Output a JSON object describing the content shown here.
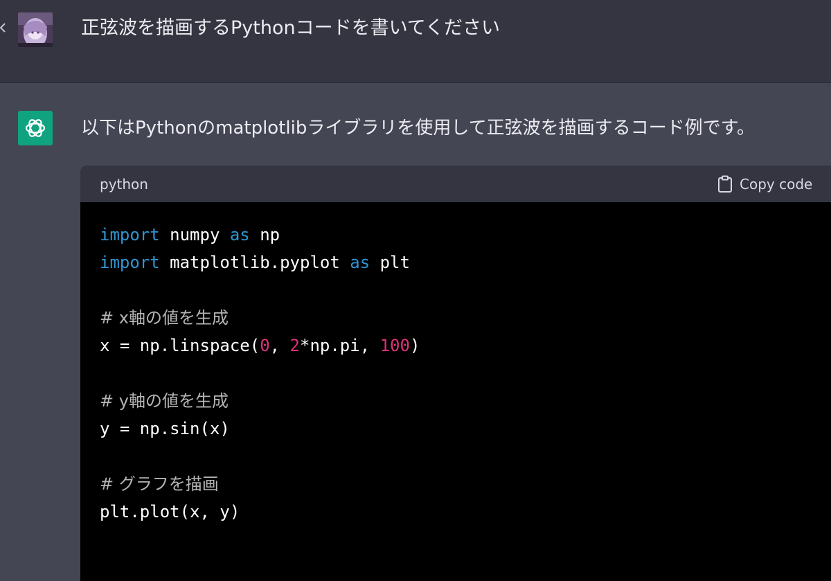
{
  "user_message": "正弦波を描画するPythonコードを書いてください",
  "assistant_message": "以下はPythonのmatplotlibライブラリを使用して正弦波を描画するコード例です。",
  "code_block": {
    "language": "python",
    "copy_label": "Copy code",
    "lines": [
      {
        "tokens": [
          {
            "t": "import",
            "c": "kw"
          },
          {
            "t": " numpy ",
            "c": ""
          },
          {
            "t": "as",
            "c": "kw"
          },
          {
            "t": " np",
            "c": ""
          }
        ]
      },
      {
        "tokens": [
          {
            "t": "import",
            "c": "kw"
          },
          {
            "t": " matplotlib.pyplot ",
            "c": ""
          },
          {
            "t": "as",
            "c": "kw"
          },
          {
            "t": " plt",
            "c": ""
          }
        ]
      },
      {
        "tokens": []
      },
      {
        "tokens": [
          {
            "t": "# x軸の値を生成",
            "c": "cm"
          }
        ]
      },
      {
        "tokens": [
          {
            "t": "x = np.linspace(",
            "c": ""
          },
          {
            "t": "0",
            "c": "num"
          },
          {
            "t": ", ",
            "c": ""
          },
          {
            "t": "2",
            "c": "num"
          },
          {
            "t": "*np.pi, ",
            "c": ""
          },
          {
            "t": "100",
            "c": "num"
          },
          {
            "t": ")",
            "c": ""
          }
        ]
      },
      {
        "tokens": []
      },
      {
        "tokens": [
          {
            "t": "# y軸の値を生成",
            "c": "cm"
          }
        ]
      },
      {
        "tokens": [
          {
            "t": "y = np.sin(x)",
            "c": ""
          }
        ]
      },
      {
        "tokens": []
      },
      {
        "tokens": [
          {
            "t": "# グラフを描画",
            "c": "cm"
          }
        ]
      },
      {
        "tokens": [
          {
            "t": "plt.plot(x, y)",
            "c": ""
          }
        ]
      },
      {
        "tokens": []
      }
    ]
  },
  "icons": {
    "user_avatar": "user-avatar-image",
    "assistant_avatar": "openai-logo-icon",
    "copy": "clipboard-icon",
    "collapse": "chevron-left-icon"
  },
  "colors": {
    "user_row_bg": "#343541",
    "assistant_row_bg": "#444654",
    "assistant_avatar_bg": "#10a37f",
    "keyword": "#2e95d3",
    "number": "#df3079"
  }
}
